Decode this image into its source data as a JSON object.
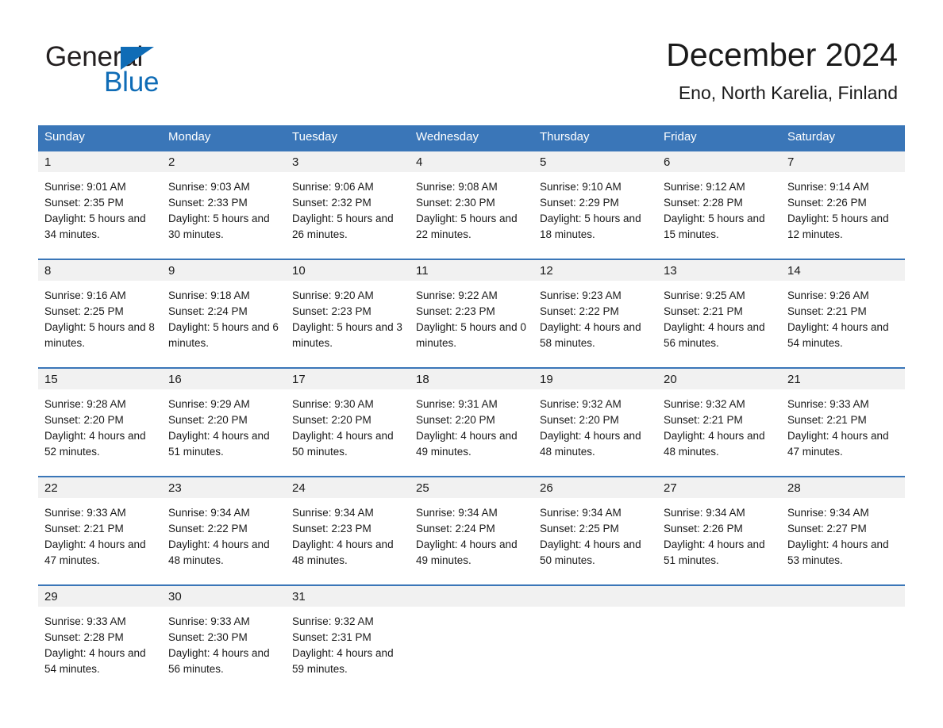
{
  "brand": {
    "logo_text_1": "General",
    "logo_text_2": "Blue",
    "logo_triangle_color": "#0f6cb6",
    "logo_primary_color": "#231f20"
  },
  "header": {
    "title": "December 2024",
    "subtitle": "Eno, North Karelia, Finland"
  },
  "theme": {
    "header_blue": "#3a76b8",
    "daynum_gray": "#f1f1f1",
    "text_color": "#1a1a1a",
    "background": "#ffffff"
  },
  "calendar": {
    "weekday_headers": [
      "Sunday",
      "Monday",
      "Tuesday",
      "Wednesday",
      "Thursday",
      "Friday",
      "Saturday"
    ],
    "labels": {
      "sunrise": "Sunrise:",
      "sunset": "Sunset:",
      "daylight": "Daylight:"
    },
    "weeks": [
      {
        "days": [
          {
            "num": "1",
            "sunrise": "Sunrise: 9:01 AM",
            "sunset": "Sunset: 2:35 PM",
            "daylight": "Daylight: 5 hours and 34 minutes."
          },
          {
            "num": "2",
            "sunrise": "Sunrise: 9:03 AM",
            "sunset": "Sunset: 2:33 PM",
            "daylight": "Daylight: 5 hours and 30 minutes."
          },
          {
            "num": "3",
            "sunrise": "Sunrise: 9:06 AM",
            "sunset": "Sunset: 2:32 PM",
            "daylight": "Daylight: 5 hours and 26 minutes."
          },
          {
            "num": "4",
            "sunrise": "Sunrise: 9:08 AM",
            "sunset": "Sunset: 2:30 PM",
            "daylight": "Daylight: 5 hours and 22 minutes."
          },
          {
            "num": "5",
            "sunrise": "Sunrise: 9:10 AM",
            "sunset": "Sunset: 2:29 PM",
            "daylight": "Daylight: 5 hours and 18 minutes."
          },
          {
            "num": "6",
            "sunrise": "Sunrise: 9:12 AM",
            "sunset": "Sunset: 2:28 PM",
            "daylight": "Daylight: 5 hours and 15 minutes."
          },
          {
            "num": "7",
            "sunrise": "Sunrise: 9:14 AM",
            "sunset": "Sunset: 2:26 PM",
            "daylight": "Daylight: 5 hours and 12 minutes."
          }
        ]
      },
      {
        "days": [
          {
            "num": "8",
            "sunrise": "Sunrise: 9:16 AM",
            "sunset": "Sunset: 2:25 PM",
            "daylight": "Daylight: 5 hours and 8 minutes."
          },
          {
            "num": "9",
            "sunrise": "Sunrise: 9:18 AM",
            "sunset": "Sunset: 2:24 PM",
            "daylight": "Daylight: 5 hours and 6 minutes."
          },
          {
            "num": "10",
            "sunrise": "Sunrise: 9:20 AM",
            "sunset": "Sunset: 2:23 PM",
            "daylight": "Daylight: 5 hours and 3 minutes."
          },
          {
            "num": "11",
            "sunrise": "Sunrise: 9:22 AM",
            "sunset": "Sunset: 2:23 PM",
            "daylight": "Daylight: 5 hours and 0 minutes."
          },
          {
            "num": "12",
            "sunrise": "Sunrise: 9:23 AM",
            "sunset": "Sunset: 2:22 PM",
            "daylight": "Daylight: 4 hours and 58 minutes."
          },
          {
            "num": "13",
            "sunrise": "Sunrise: 9:25 AM",
            "sunset": "Sunset: 2:21 PM",
            "daylight": "Daylight: 4 hours and 56 minutes."
          },
          {
            "num": "14",
            "sunrise": "Sunrise: 9:26 AM",
            "sunset": "Sunset: 2:21 PM",
            "daylight": "Daylight: 4 hours and 54 minutes."
          }
        ]
      },
      {
        "days": [
          {
            "num": "15",
            "sunrise": "Sunrise: 9:28 AM",
            "sunset": "Sunset: 2:20 PM",
            "daylight": "Daylight: 4 hours and 52 minutes."
          },
          {
            "num": "16",
            "sunrise": "Sunrise: 9:29 AM",
            "sunset": "Sunset: 2:20 PM",
            "daylight": "Daylight: 4 hours and 51 minutes."
          },
          {
            "num": "17",
            "sunrise": "Sunrise: 9:30 AM",
            "sunset": "Sunset: 2:20 PM",
            "daylight": "Daylight: 4 hours and 50 minutes."
          },
          {
            "num": "18",
            "sunrise": "Sunrise: 9:31 AM",
            "sunset": "Sunset: 2:20 PM",
            "daylight": "Daylight: 4 hours and 49 minutes."
          },
          {
            "num": "19",
            "sunrise": "Sunrise: 9:32 AM",
            "sunset": "Sunset: 2:20 PM",
            "daylight": "Daylight: 4 hours and 48 minutes."
          },
          {
            "num": "20",
            "sunrise": "Sunrise: 9:32 AM",
            "sunset": "Sunset: 2:21 PM",
            "daylight": "Daylight: 4 hours and 48 minutes."
          },
          {
            "num": "21",
            "sunrise": "Sunrise: 9:33 AM",
            "sunset": "Sunset: 2:21 PM",
            "daylight": "Daylight: 4 hours and 47 minutes."
          }
        ]
      },
      {
        "days": [
          {
            "num": "22",
            "sunrise": "Sunrise: 9:33 AM",
            "sunset": "Sunset: 2:21 PM",
            "daylight": "Daylight: 4 hours and 47 minutes."
          },
          {
            "num": "23",
            "sunrise": "Sunrise: 9:34 AM",
            "sunset": "Sunset: 2:22 PM",
            "daylight": "Daylight: 4 hours and 48 minutes."
          },
          {
            "num": "24",
            "sunrise": "Sunrise: 9:34 AM",
            "sunset": "Sunset: 2:23 PM",
            "daylight": "Daylight: 4 hours and 48 minutes."
          },
          {
            "num": "25",
            "sunrise": "Sunrise: 9:34 AM",
            "sunset": "Sunset: 2:24 PM",
            "daylight": "Daylight: 4 hours and 49 minutes."
          },
          {
            "num": "26",
            "sunrise": "Sunrise: 9:34 AM",
            "sunset": "Sunset: 2:25 PM",
            "daylight": "Daylight: 4 hours and 50 minutes."
          },
          {
            "num": "27",
            "sunrise": "Sunrise: 9:34 AM",
            "sunset": "Sunset: 2:26 PM",
            "daylight": "Daylight: 4 hours and 51 minutes."
          },
          {
            "num": "28",
            "sunrise": "Sunrise: 9:34 AM",
            "sunset": "Sunset: 2:27 PM",
            "daylight": "Daylight: 4 hours and 53 minutes."
          }
        ]
      },
      {
        "days": [
          {
            "num": "29",
            "sunrise": "Sunrise: 9:33 AM",
            "sunset": "Sunset: 2:28 PM",
            "daylight": "Daylight: 4 hours and 54 minutes."
          },
          {
            "num": "30",
            "sunrise": "Sunrise: 9:33 AM",
            "sunset": "Sunset: 2:30 PM",
            "daylight": "Daylight: 4 hours and 56 minutes."
          },
          {
            "num": "31",
            "sunrise": "Sunrise: 9:32 AM",
            "sunset": "Sunset: 2:31 PM",
            "daylight": "Daylight: 4 hours and 59 minutes."
          },
          {
            "num": "",
            "sunrise": "",
            "sunset": "",
            "daylight": ""
          },
          {
            "num": "",
            "sunrise": "",
            "sunset": "",
            "daylight": ""
          },
          {
            "num": "",
            "sunrise": "",
            "sunset": "",
            "daylight": ""
          },
          {
            "num": "",
            "sunrise": "",
            "sunset": "",
            "daylight": ""
          }
        ]
      }
    ]
  }
}
